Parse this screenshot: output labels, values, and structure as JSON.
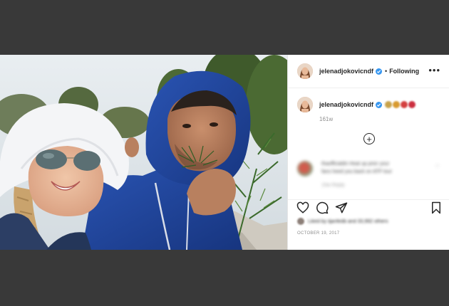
{
  "post": {
    "username": "jelenadjokovicndf",
    "verified": true,
    "follow_label": "Following",
    "separator": "•",
    "more_label": "•••",
    "caption_emojis": [
      "#c8a24a",
      "#d89a30",
      "#d4403f",
      "#cc2f3f"
    ],
    "timestamp": "161w",
    "load_more_label": "+",
    "comment": {
      "author": "thaofficialdn",
      "text_line1": "thaofficialdn Heat up prior your",
      "text_line2": "fans heed you back on ATP tour",
      "meta": "10w   Reply",
      "like_label": "♡"
    },
    "likes_text": "Liked by iljanfedb and 33,992 others",
    "date": "OCTOBER 19, 2017"
  },
  "icons": {
    "like": "heart-icon",
    "comment": "comment-icon",
    "share": "share-icon",
    "save": "bookmark-icon",
    "more": "more-options-icon",
    "verified": "verified-badge-icon",
    "add": "add-circle-icon"
  },
  "colors": {
    "background": "#393939",
    "verified_blue": "#3897f0",
    "text_primary": "#262626",
    "text_secondary": "#8e8e8e",
    "hoodie_blue": "#1e3f8f"
  }
}
